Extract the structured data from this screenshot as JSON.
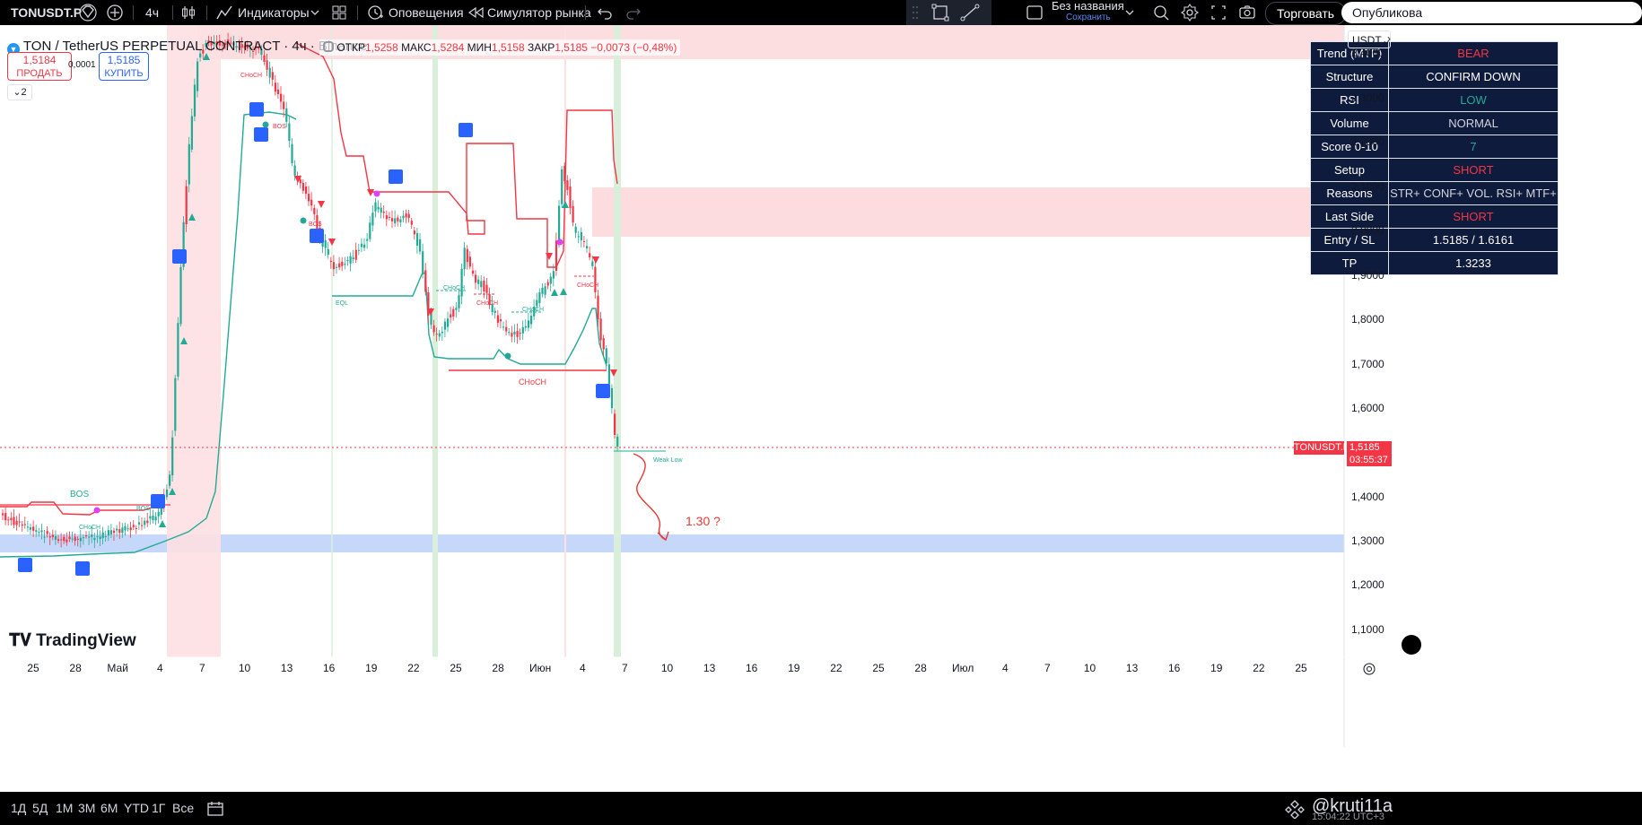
{
  "topbar": {
    "symbol": "TONUSDT.P",
    "interval": "4ч",
    "indicators_label": "Индикаторы",
    "alerts_label": "Оповещения",
    "replay_label": "Симулятор рынка",
    "layout_name": "Без названия",
    "layout_sub": "Сохранить",
    "trade_label": "Торговать",
    "publish_label": "Опубликова"
  },
  "legend": {
    "title": "TON / TetherUS PERPETUAL CONTRACT · 4ч · Binance",
    "o_label": "ОТКР",
    "o_val": "1,5258",
    "h_label": "МАКС",
    "h_val": "1,5284",
    "l_label": "МИН",
    "l_val": "1,5158",
    "c_label": "ЗАКР",
    "c_val": "1,5185",
    "chg": "−0,0073 (−0,48%)",
    "sell_price": "1,5184",
    "sell_label": "ПРОДАТЬ",
    "spread": "0,0001",
    "buy_price": "1,5185",
    "buy_label": "КУПИТЬ",
    "collapse_count": "2"
  },
  "info_table": [
    {
      "k": "Trend (MTF)",
      "v": "BEAR",
      "color": "#f23645"
    },
    {
      "k": "Structure",
      "v": "CONFIRM DOWN",
      "color": "#ffffff"
    },
    {
      "k": "RSI",
      "v": "LOW",
      "color": "#22ab94"
    },
    {
      "k": "Volume",
      "v": "NORMAL",
      "color": "#d1d4dc"
    },
    {
      "k": "Score 0-10",
      "v": "7",
      "color": "#22ab94"
    },
    {
      "k": "Setup",
      "v": "SHORT",
      "color": "#f23645"
    },
    {
      "k": "Reasons",
      "v": "STR+ CONF+ VOL. RSI+ MTF+",
      "color": "#d1d4dc"
    },
    {
      "k": "Last Side",
      "v": "SHORT",
      "color": "#f23645"
    },
    {
      "k": "Entry / SL",
      "v": "1.5185 / 1.6161",
      "color": "#ffffff"
    },
    {
      "k": "TP",
      "v": "1.3233",
      "color": "#ffffff"
    }
  ],
  "y_axis": {
    "currency": "USDT",
    "ticks": [
      "2,4000",
      "2,3000",
      "2,2000",
      "2,1000",
      "2,0000",
      "1,9000",
      "1,8000",
      "1,7000",
      "1,6000",
      "1,4000",
      "1,3000",
      "1,2000",
      "1,1000"
    ],
    "price_tag": "1,5185",
    "countdown": "03:55:37",
    "symbol_tag": "TONUSDT.P"
  },
  "x_axis": [
    "25",
    "28",
    "Май",
    "4",
    "7",
    "10",
    "13",
    "16",
    "19",
    "22",
    "25",
    "28",
    "Июн",
    "4",
    "7",
    "10",
    "13",
    "16",
    "19",
    "22",
    "25",
    "28",
    "Июл",
    "4",
    "7",
    "10",
    "13",
    "16",
    "19",
    "22",
    "25"
  ],
  "annotations": {
    "bos1": "BOS",
    "bos2": "BOS",
    "bos3": "BOS",
    "bos4": "BOS",
    "choch1": "CHoCH",
    "choch2": "CHoCH",
    "choch3": "CHoCH",
    "choch4": "CHoCH",
    "choch5": "CHoCH",
    "choch6": "CHoCH",
    "choch7": "CHoCH",
    "eql": "EQL",
    "weak_low": "Weak Low",
    "target_note": "1.30 ?"
  },
  "watermark": "TradingView",
  "bottom": {
    "ranges": [
      "1Д",
      "5Д",
      "1М",
      "3М",
      "6М",
      "YTD",
      "1Г",
      "Все"
    ],
    "time": "15:04:22 UTC+3",
    "overlay_user": "@kruti11a"
  },
  "colors": {
    "bull": "#22ab94",
    "bear": "#f23645",
    "accent": "#2962ff"
  }
}
